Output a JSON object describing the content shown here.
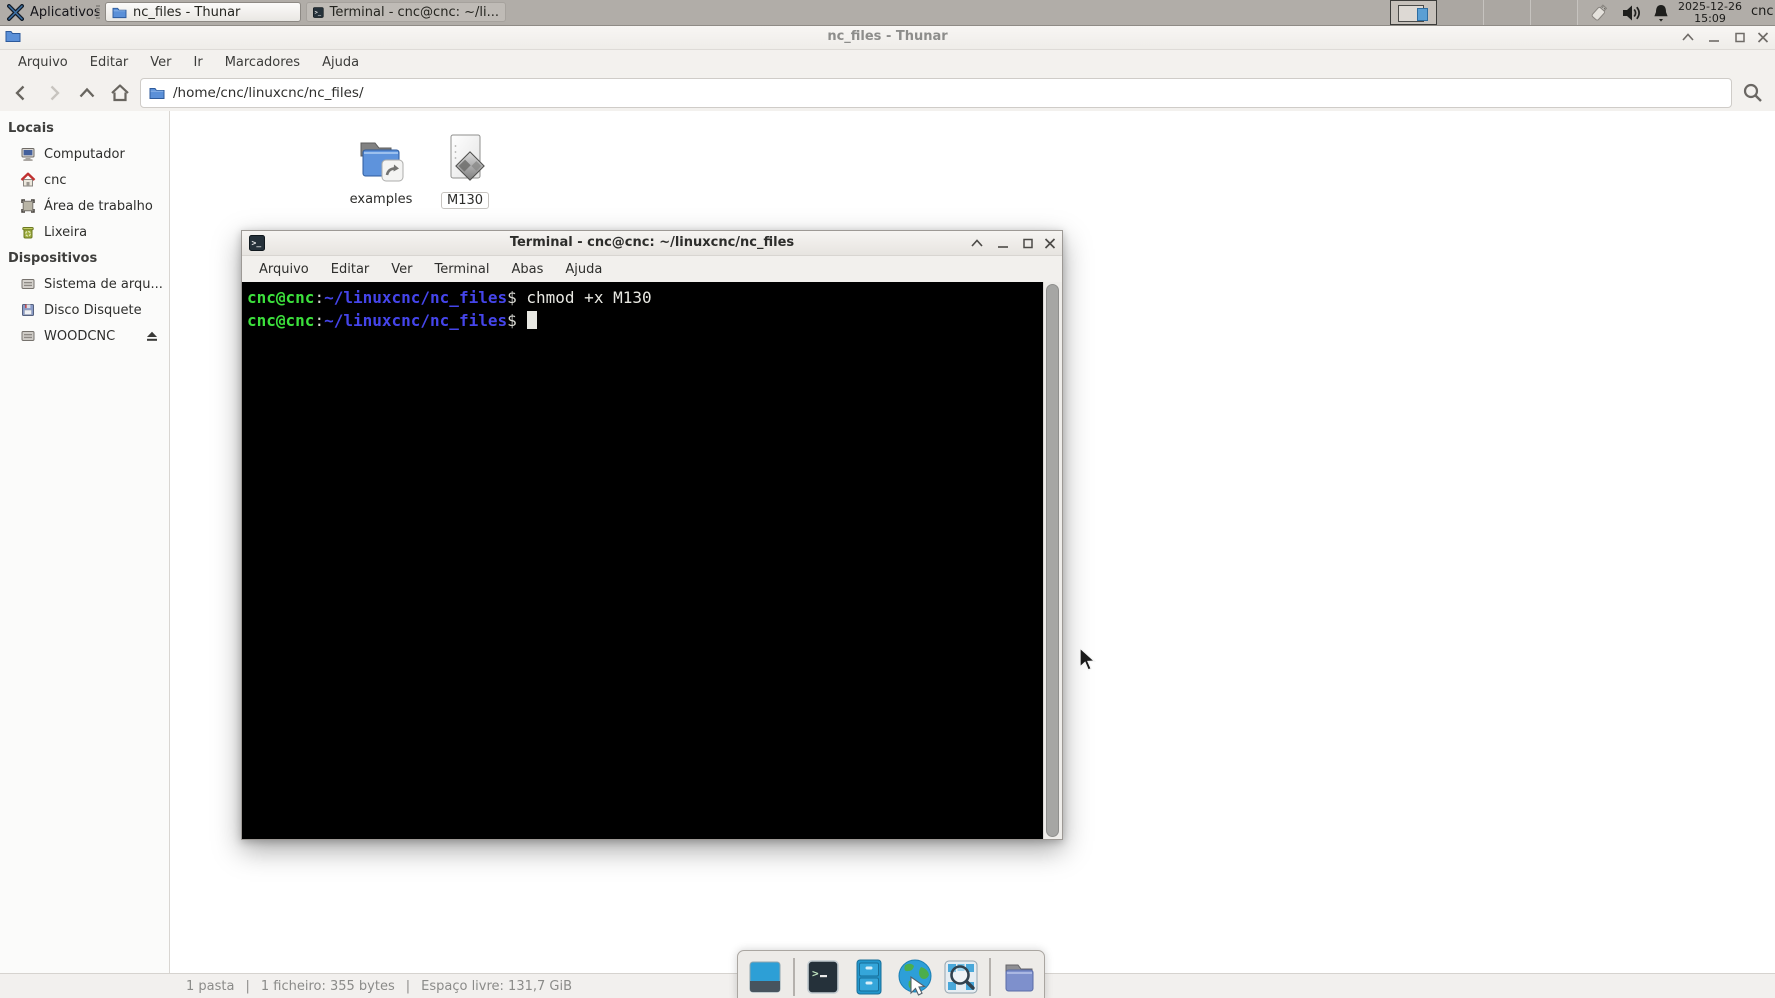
{
  "panel": {
    "applications_label": "Aplicativos",
    "taskbar": [
      {
        "label": "nc_files - Thunar",
        "icon": "folder-icon",
        "state": "active"
      },
      {
        "label": "Terminal - cnc@cnc: ~/li...",
        "icon": "terminal-icon",
        "state": "normal"
      }
    ],
    "workspaces": {
      "count": 4,
      "active": 1
    },
    "tray_icons": [
      "removable-media-icon",
      "volume-icon",
      "notifications-icon"
    ],
    "clock": {
      "date": "2025-12-26",
      "time": "15:09"
    },
    "user": "cnc"
  },
  "thunar": {
    "title": "nc_files - Thunar",
    "menu": [
      "Arquivo",
      "Editar",
      "Ver",
      "Ir",
      "Marcadores",
      "Ajuda"
    ],
    "toolbar": {
      "path": "/home/cnc/linuxcnc/nc_files/"
    },
    "sidebar": {
      "sections": [
        {
          "header": "Locais",
          "items": [
            {
              "label": "Computador",
              "icon": "computer-icon"
            },
            {
              "label": "cnc",
              "icon": "home-icon"
            },
            {
              "label": "Área de trabalho",
              "icon": "desktop-icon"
            },
            {
              "label": "Lixeira",
              "icon": "trash-icon"
            }
          ]
        },
        {
          "header": "Dispositivos",
          "items": [
            {
              "label": "Sistema de arqu...",
              "icon": "harddrive-icon"
            },
            {
              "label": "Disco Disquete",
              "icon": "floppy-icon"
            },
            {
              "label": "WOODCNC",
              "icon": "harddrive-icon",
              "eject": true
            }
          ]
        }
      ]
    },
    "files": [
      {
        "label": "examples",
        "type": "folder-shortcut"
      },
      {
        "label": "M130",
        "type": "executable-file",
        "selected": true
      }
    ],
    "statusbar": {
      "parts": [
        "1 pasta",
        "1 ficheiro: 355 bytes",
        "Espaço livre: 131,7 GiB"
      ],
      "separator": "|"
    }
  },
  "terminal": {
    "title": "Terminal - cnc@cnc: ~/linuxcnc/nc_files",
    "menu": [
      "Arquivo",
      "Editar",
      "Ver",
      "Terminal",
      "Abas",
      "Ajuda"
    ],
    "lines": [
      {
        "user": "cnc@cnc",
        "colon": ":",
        "path": "~/linuxcnc/nc_files",
        "dollar": "$",
        "command": " chmod +x M130"
      },
      {
        "user": "cnc@cnc",
        "colon": ":",
        "path": "~/linuxcnc/nc_files",
        "dollar": "$",
        "command": ""
      }
    ],
    "colors": {
      "prompt_user": "#3ce03c",
      "prompt_path": "#4545ea",
      "foreground": "#e8e8e2",
      "background": "#000000"
    }
  },
  "dock": {
    "items": [
      "desktop-preview-icon",
      "separator",
      "terminal-icon",
      "filecabinet-icon",
      "browser-icon",
      "appfinder-icon",
      "separator",
      "folder-icon"
    ]
  }
}
